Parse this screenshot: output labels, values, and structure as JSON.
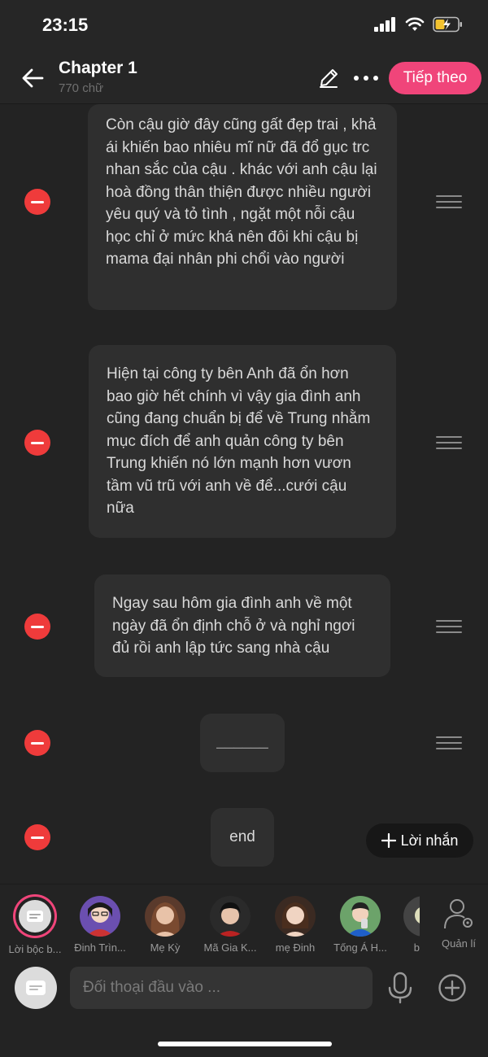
{
  "status": {
    "time": "23:15"
  },
  "header": {
    "title": "Chapter 1",
    "word_count": "770 chữ",
    "next_label": "Tiếp theo"
  },
  "messages": [
    {
      "text": "Còn cậu giờ đây cũng gất đẹp trai , khả ái khiến bao nhiêu mĩ nữ đã đổ gục trc nhan sắc của cậu . khác với anh cậu lại hoà đồng thân thiện được nhiều người yêu quý và tỏ tình , ngặt một nỗi cậu học chỉ ở mức khá nên đôi khi cậu bị mama đại nhân phi chổi vào người"
    },
    {
      "text": "Hiện tại công ty bên Anh đã ổn hơn bao giờ hết chính vì vậy gia đình anh cũng đang chuẩn bị để về Trung nhằm mục đích để anh quản công ty bên Trung khiến nó lớn mạnh hơn vươn tầm vũ trũ với anh về để...cưới cậu nữa"
    },
    {
      "text": "Ngay sau hôm gia đình anh về một ngày đã ổn định chỗ ở và nghỉ ngơi đủ rồi anh lập tức sang nhà cậu"
    },
    {
      "text": "______"
    },
    {
      "text": "end"
    }
  ],
  "add_note_label": "Lời nhắn",
  "characters": [
    {
      "name": "Lời bộc b...",
      "icon": "narration-icon"
    },
    {
      "name": "Đinh Trìn...",
      "icon": "avatar"
    },
    {
      "name": "Mẹ Kỳ",
      "icon": "avatar"
    },
    {
      "name": "Mã Gia K...",
      "icon": "avatar"
    },
    {
      "name": "mẹ Đinh",
      "icon": "avatar"
    },
    {
      "name": "Tống Á H...",
      "icon": "avatar"
    },
    {
      "name": "b",
      "icon": "avatar"
    }
  ],
  "manage_label": "Quản lí",
  "input": {
    "placeholder": "Đối thoại đầu vào ..."
  },
  "colors": {
    "accent": "#f0457a",
    "remove": "#ef3b3b",
    "background": "#232323",
    "bubble": "#2f2f2f"
  }
}
